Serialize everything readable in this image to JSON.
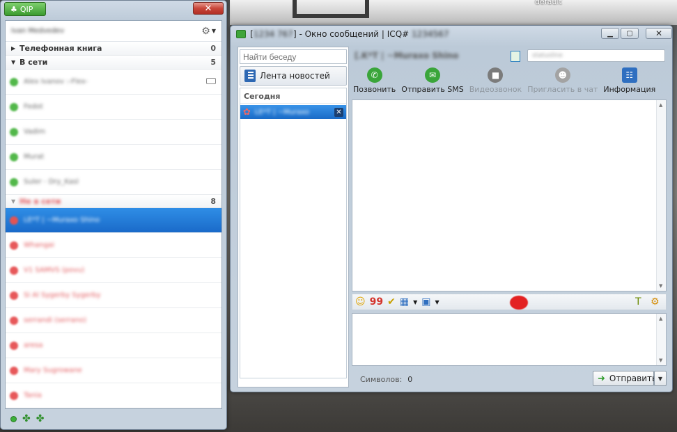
{
  "background": {
    "corner_text": "default"
  },
  "qip": {
    "app_title": "QIP",
    "close_label": "✕",
    "account_name": "Ivan Medvedev",
    "groups": [
      {
        "label": "Телефонная книга",
        "count": "0"
      },
      {
        "label": "В сети",
        "count": "5"
      }
    ],
    "online_contacts": [
      "Alex Ivanov :-Flex-",
      "Fedot",
      "Vadim",
      "Murat",
      "Suler - Dry_Kasl"
    ],
    "offline_group": {
      "label": "Не в сети",
      "count": "8"
    },
    "offline_contacts": [
      "LE*T | ~Muraxo Shino",
      "Whangai",
      "V1 SAMVS (povu)",
      "Si Al Sygerby Sygerby",
      "serrandi (serrano)",
      "aresa",
      "Mary Sugrowane",
      "Tania"
    ]
  },
  "message_window": {
    "title_id": "1234 767",
    "title_text": "] - Окно сообщений | ICQ#",
    "title_number": "1234567",
    "search_placeholder": "Найти беседу",
    "news_feed_label": "Лента новостей",
    "today_label": "Сегодня",
    "chat_item_name": "LE*T | ~Muraxo",
    "contact_name": "[.K*T | ~Muraxo Shino",
    "status_text": "statusline",
    "toolbar": [
      {
        "label": "Позвонить",
        "icon": "phone-icon",
        "color": "#3aa53a",
        "enabled": true
      },
      {
        "label": "Отправить SMS",
        "icon": "sms-icon",
        "color": "#3aa53a",
        "enabled": true
      },
      {
        "label": "Видеозвонок",
        "icon": "video-call-icon",
        "color": "#7b7b7b",
        "enabled": false
      },
      {
        "label": "Пригласить в чат",
        "icon": "invite-icon",
        "color": "#8d8d8d",
        "enabled": false
      },
      {
        "label": "Информация",
        "icon": "info-card-icon",
        "color": "#2f6fc0",
        "enabled": true
      }
    ],
    "chars_label": "Символов:",
    "chars_value": "0",
    "send_label": "Отправить"
  }
}
